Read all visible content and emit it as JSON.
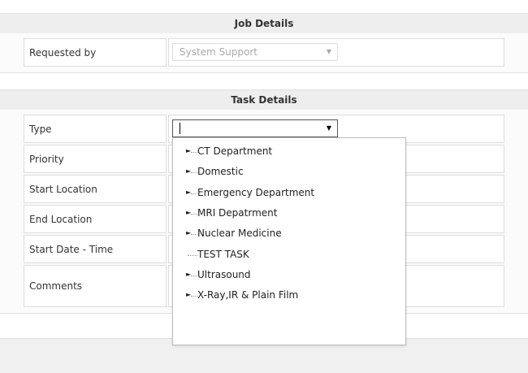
{
  "job_details": {
    "title": "Job Details",
    "requested_by_label": "Requested by",
    "requested_by_value": "System Support"
  },
  "task_details": {
    "title": "Task Details",
    "labels": {
      "type": "Type",
      "priority": "Priority",
      "start_location": "Start Location",
      "end_location": "End Location",
      "start_date_time": "Start Date - Time",
      "comments": "Comments"
    },
    "type_value": ""
  },
  "icons": {
    "dropdown_arrow": "▼",
    "tree_expand": "►"
  },
  "type_dropdown": {
    "items": [
      {
        "label": "CT Department",
        "expandable": true
      },
      {
        "label": "Domestic",
        "expandable": true
      },
      {
        "label": "Emergency Department",
        "expandable": true
      },
      {
        "label": "MRI Depatrment",
        "expandable": true
      },
      {
        "label": "Nuclear Medicine",
        "expandable": true
      },
      {
        "label": "TEST TASK",
        "expandable": false
      },
      {
        "label": "Ultrasound",
        "expandable": true
      },
      {
        "label": "X-Ray,IR & Plain Film",
        "expandable": true
      }
    ]
  },
  "colors": {
    "header_bg": "#eeeeee",
    "border": "#dddddd",
    "disabled_text": "#a9a9a9"
  }
}
